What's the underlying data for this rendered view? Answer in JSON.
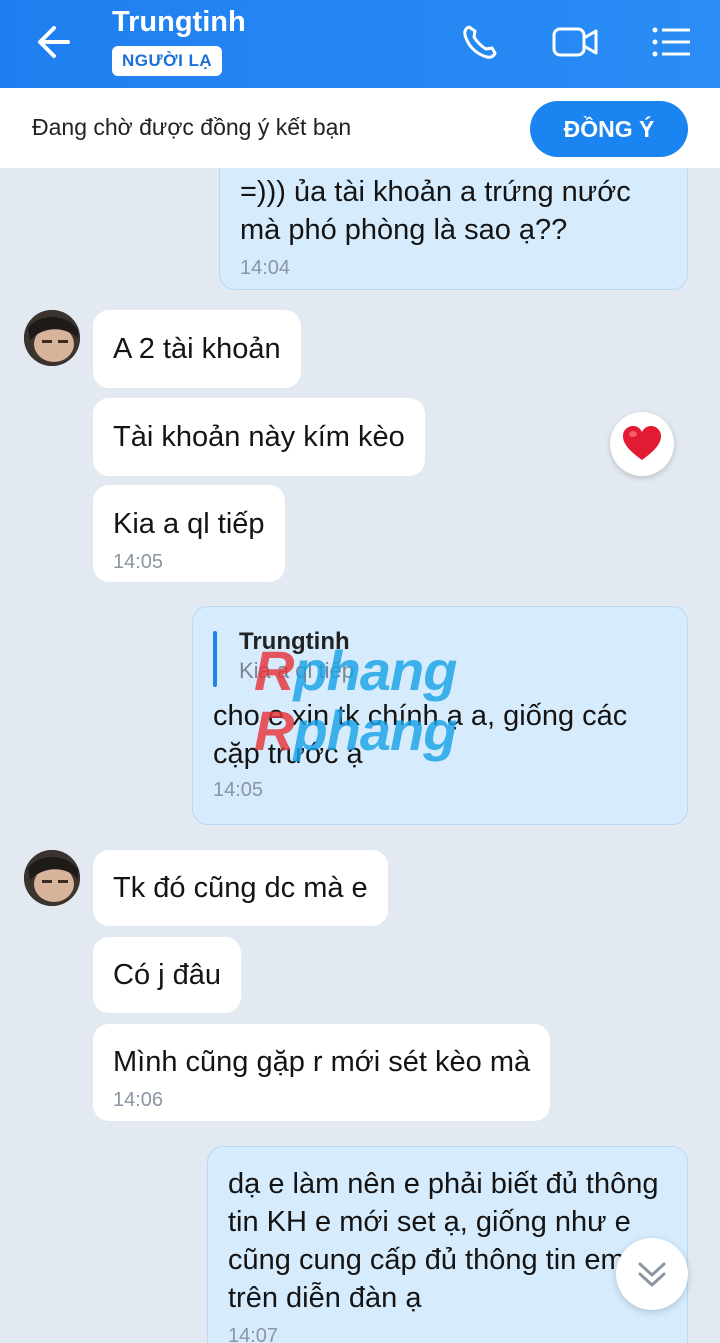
{
  "header": {
    "title": "Trungtinh",
    "badge": "NGƯỜI LẠ"
  },
  "pending": {
    "text": "Đang chờ được đồng ý kết bạn",
    "button": "ĐỒNG Ý"
  },
  "messages": [
    {
      "side": "out",
      "text": "=))) ủa tài khoản a trứng nước mà phó phòng là sao ạ??",
      "time": "14:04"
    },
    {
      "side": "in",
      "text": "A 2 tài khoản"
    },
    {
      "side": "in",
      "text": "Tài khoản này kím kèo",
      "reaction": "heart"
    },
    {
      "side": "in",
      "text": "Kia a ql tiếp",
      "time": "14:05"
    },
    {
      "side": "out",
      "quote_name": "Trungtinh",
      "quote_text": "Kia a ql tiếp",
      "text": "cho e xin tk chính ạ a, giống các cặp trước ạ",
      "time": "14:05"
    },
    {
      "side": "in",
      "text": "Tk đó cũng dc mà e"
    },
    {
      "side": "in",
      "text": "Có j đâu"
    },
    {
      "side": "in",
      "text": "Mình cũng gặp r mới sét kèo mà",
      "time": "14:06"
    },
    {
      "side": "out",
      "text": "dạ e làm nên e phải biết đủ thông tin KH e mới set ạ, giống như e cũng cung cấp đủ thông tin em trên diễn đàn ạ",
      "time": "14:07"
    }
  ],
  "watermark": "Rphang",
  "icons": [
    "back-arrow-icon",
    "phone-icon",
    "video-call-icon",
    "menu-icon",
    "heart-icon",
    "chevron-down-icon"
  ],
  "colors": {
    "header": "#2a8cf5",
    "accent": "#1a85f0",
    "outgoing_bubble": "#d6ecfd",
    "incoming_bubble": "#ffffff",
    "background": "#e3e9f1"
  }
}
